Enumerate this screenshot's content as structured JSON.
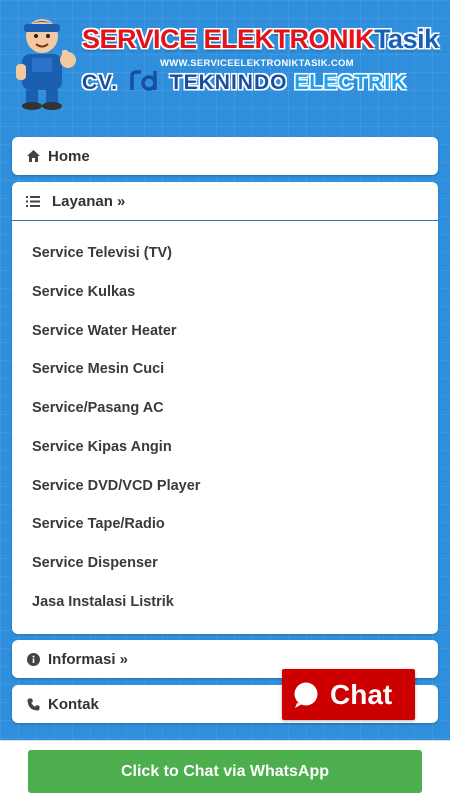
{
  "header": {
    "brand_main": "SERVICE ELEKTRONIK",
    "brand_tasik": "Tasik",
    "brand_url": "WWW.SERVICEELEKTRONIKTASIK.COM",
    "brand_cv": "CV.",
    "brand_teknindo": "TEKNINDO",
    "brand_electrik": "ELECTRIK"
  },
  "menu": {
    "home": {
      "label": "Home",
      "icon": "home-icon"
    },
    "layanan": {
      "label": "Layanan »",
      "icon": "list-icon"
    },
    "informasi": {
      "label": "Informasi »",
      "icon": "info-icon"
    },
    "kontak": {
      "label": "Kontak",
      "icon": "phone-icon"
    }
  },
  "submenu": {
    "items": [
      "Service Televisi (TV)",
      "Service Kulkas",
      "Service Water Heater",
      "Service Mesin Cuci",
      "Service/Pasang AC",
      "Service Kipas Angin",
      "Service DVD/VCD Player",
      "Service Tape/Radio",
      "Service Dispenser",
      "Jasa Instalasi Listrik"
    ]
  },
  "chat_widget": {
    "label": "Chat",
    "icon": "chat-bubble-icon"
  },
  "whatsapp": {
    "label": "Click to Chat via WhatsApp"
  },
  "colors": {
    "background": "#2f8fdc",
    "brand_red": "#e3131b",
    "brand_blue": "#1a4fa0",
    "chat_red": "#cc0000",
    "whatsapp_green": "#4cae4c"
  }
}
